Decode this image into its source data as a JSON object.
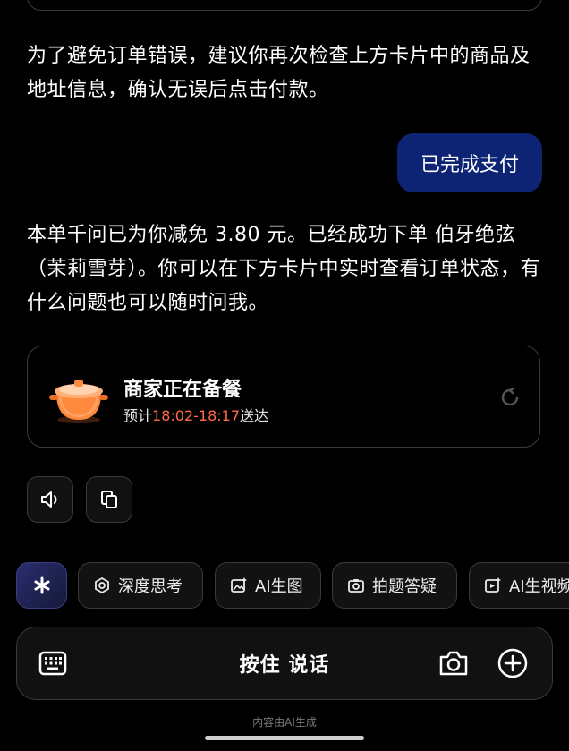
{
  "messages": {
    "verify_text": "为了避免订单错误，建议你再次检查上方卡片中的商品及地址信息，确认无误后点击付款。",
    "user_bubble": "已完成支付",
    "reply_text": "本单千问已为你减免 3.80 元。已经成功下单 伯牙绝弦（茉莉雪芽）。你可以在下方卡片中实时查看订单状态，有什么问题也可以随时问我。"
  },
  "order_card": {
    "title": "商家正在备餐",
    "eta_prefix": "预计",
    "eta_time": "18:02-18:17",
    "eta_suffix": "送达",
    "accent_color": "#ff6b4a"
  },
  "chips": [
    {
      "label": "",
      "icon": "sparkle-icon"
    },
    {
      "label": "深度思考",
      "icon": "deep-think-icon"
    },
    {
      "label": "AI生图",
      "icon": "image-gen-icon"
    },
    {
      "label": "拍题答疑",
      "icon": "camera-question-icon"
    },
    {
      "label": "AI生视频",
      "icon": "video-gen-icon"
    }
  ],
  "input_bar": {
    "hold_to_talk": "按住 说话"
  },
  "footer_note": "内容由AI生成",
  "colors": {
    "background": "#000000",
    "user_bubble": "#0d2474",
    "border": "#3a3a3a"
  }
}
